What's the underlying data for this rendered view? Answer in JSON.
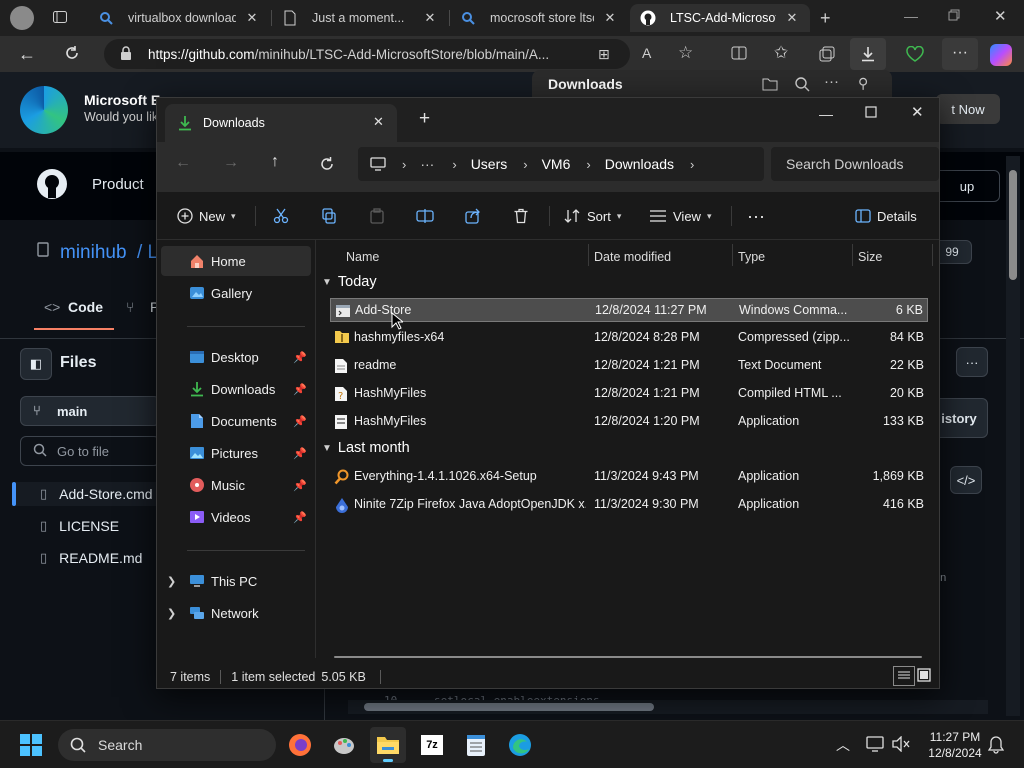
{
  "browser": {
    "tabs": [
      {
        "label": "virtualbox download o",
        "icon": "search-icon"
      },
      {
        "label": "Just a moment...",
        "icon": "page-icon"
      },
      {
        "label": "mocrosoft store ltsc m",
        "icon": "search-icon"
      },
      {
        "label": "LTSC-Add-MicrosoftSt",
        "icon": "github-icon",
        "active": true
      }
    ],
    "url_host": "https://github.com",
    "url_path": "/minihub/LTSC-Add-MicrosoftStore/blob/main/A...",
    "downloads_panel_title": "Downloads"
  },
  "github": {
    "edge_banner_title": "Microsoft E",
    "edge_banner_sub": "Would you lik",
    "edge_banner_button": "t Now",
    "nav_product": "Product",
    "signup": "up",
    "repo_owner": "minihub",
    "repo_sep": "/ L",
    "tab_code": "Code",
    "tab_pulls": "P",
    "star_count": "99",
    "files_title": "Files",
    "branch": "main",
    "goto_placeholder": "Go to file",
    "files": [
      "Add-Store.cmd",
      "LICENSE",
      "README.md"
    ],
    "history": "istory",
    "code_line_no": "10",
    "code_text": "setlocal enableextensions",
    "side_snippet": "on"
  },
  "explorer": {
    "tab_title": "Downloads",
    "breadcrumb": [
      "Users",
      "VM6",
      "Downloads"
    ],
    "search_placeholder": "Search Downloads",
    "commands": {
      "new": "New",
      "sort": "Sort",
      "view": "View",
      "details": "Details"
    },
    "sidebar": {
      "home": "Home",
      "gallery": "Gallery",
      "desktop": "Desktop",
      "downloads": "Downloads",
      "documents": "Documents",
      "pictures": "Pictures",
      "music": "Music",
      "videos": "Videos",
      "this_pc": "This PC",
      "network": "Network"
    },
    "columns": {
      "name": "Name",
      "date": "Date modified",
      "type": "Type",
      "size": "Size"
    },
    "groups": [
      {
        "label": "Today",
        "files": [
          {
            "name": "Add-Store",
            "date": "12/8/2024 11:27 PM",
            "type": "Windows Comma...",
            "size": "6 KB",
            "icon": "cmd-file-icon",
            "selected": true
          },
          {
            "name": "hashmyfiles-x64",
            "date": "12/8/2024 8:28 PM",
            "type": "Compressed (zipp...",
            "size": "84 KB",
            "icon": "zip-folder-icon"
          },
          {
            "name": "readme",
            "date": "12/8/2024 1:21 PM",
            "type": "Text Document",
            "size": "22 KB",
            "icon": "text-file-icon"
          },
          {
            "name": "HashMyFiles",
            "date": "12/8/2024 1:21 PM",
            "type": "Compiled HTML ...",
            "size": "20 KB",
            "icon": "chm-file-icon"
          },
          {
            "name": "HashMyFiles",
            "date": "12/8/2024 1:20 PM",
            "type": "Application",
            "size": "133 KB",
            "icon": "app-file-icon"
          }
        ]
      },
      {
        "label": "Last month",
        "files": [
          {
            "name": "Everything-1.4.1.1026.x64-Setup",
            "date": "11/3/2024 9:43 PM",
            "type": "Application",
            "size": "1,869 KB",
            "icon": "everything-icon"
          },
          {
            "name": "Ninite 7Zip Firefox Java AdoptOpenJDK x...",
            "date": "11/3/2024 9:30 PM",
            "type": "Application",
            "size": "416 KB",
            "icon": "ninite-icon"
          }
        ]
      }
    ],
    "status": {
      "items": "7 items",
      "selected": "1 item selected",
      "size": "5.05 KB"
    }
  },
  "taskbar": {
    "search_label": "Search",
    "time": "11:27 PM",
    "date": "12/8/2024"
  },
  "colors": {
    "accent": "#60cdff",
    "folder": "#f3c94c",
    "github_link": "#4493f8"
  }
}
